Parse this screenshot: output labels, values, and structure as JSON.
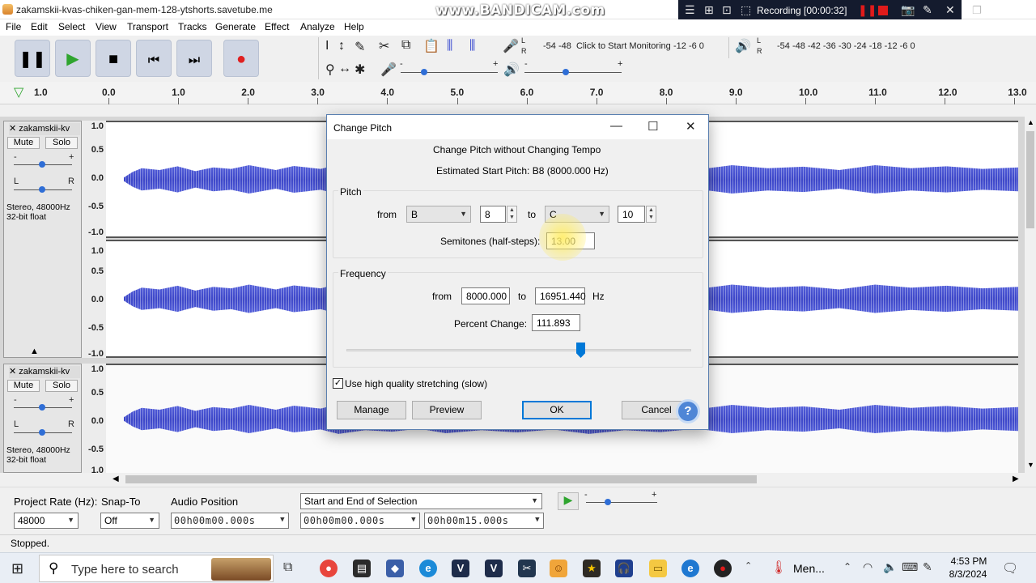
{
  "window": {
    "title": "zakamskii-kvas-chiken-gan-mem-128-ytshorts.savetube.me",
    "watermark": "www.BANDICAM.com"
  },
  "bandicam": {
    "recording_label": "Recording [00:00:32]"
  },
  "menu": [
    "File",
    "Edit",
    "Select",
    "View",
    "Transport",
    "Tracks",
    "Generate",
    "Effect",
    "Analyze",
    "Help"
  ],
  "transport": {
    "buttons": [
      "pause",
      "play",
      "stop",
      "skip-start",
      "skip-end",
      "record"
    ]
  },
  "meters": {
    "record_scale": "-54  -48",
    "record_hint": "Click to Start Monitoring",
    "record_tail": "-12  -6  0",
    "play_scale": "-54  -48  -42  -36  -30  -24  -18  -12  -6  0",
    "lr_l": "L",
    "lr_r": "R"
  },
  "ruler": {
    "start_label": "1.0",
    "ticks": [
      "0.0",
      "1.0",
      "2.0",
      "3.0",
      "4.0",
      "5.0",
      "6.0",
      "7.0",
      "8.0",
      "9.0",
      "10.0",
      "11.0",
      "12.0",
      "13.0"
    ]
  },
  "tracks": [
    {
      "name": "zakamskii-kv",
      "mute": "Mute",
      "solo": "Solo",
      "gain_minus": "-",
      "gain_plus": "+",
      "pan_l": "L",
      "pan_r": "R",
      "info_line1": "Stereo, 48000Hz",
      "info_line2": "32-bit float",
      "scale_top": [
        "1.0",
        "0.5",
        "0.0",
        "-0.5",
        "-1.0"
      ],
      "scale_bottom": [
        "1.0",
        "0.5",
        "0.0",
        "-0.5",
        "-1.0"
      ]
    },
    {
      "name": "zakamskii-kv",
      "mute": "Mute",
      "solo": "Solo",
      "gain_minus": "-",
      "gain_plus": "+",
      "pan_l": "L",
      "pan_r": "R",
      "info_line1": "Stereo, 48000Hz",
      "info_line2": "32-bit float",
      "scale_top": [
        "1.0",
        "0.5",
        "0.0",
        "-0.5",
        "1.0"
      ]
    }
  ],
  "selection_toolbar": {
    "project_rate_label": "Project Rate (Hz):",
    "project_rate_value": "48000",
    "snap_to_label": "Snap-To",
    "snap_to_value": "Off",
    "audio_position_label": "Audio Position",
    "audio_position_value": "00h00m00.000s",
    "selection_mode": "Start and End of Selection",
    "selection_start": "00h00m00.000s",
    "selection_end": "00h00m15.000s"
  },
  "status": "Stopped.",
  "dialog": {
    "title": "Change Pitch",
    "heading": "Change Pitch without Changing Tempo",
    "estimated": "Estimated Start Pitch: B8 (8000.000 Hz)",
    "pitch_group": "Pitch",
    "from_label": "from",
    "from_note": "B",
    "from_octave": "8",
    "to_label": "to",
    "to_note": "C",
    "to_octave": "10",
    "semitones_label": "Semitones (half-steps):",
    "semitones_value": "13.00",
    "frequency_group": "Frequency",
    "freq_from_label": "from",
    "freq_from": "8000.000",
    "freq_to_label": "to",
    "freq_to": "16951.440",
    "hz": "Hz",
    "percent_label": "Percent Change:",
    "percent_value": "111.893",
    "hq_checkbox": "Use high quality stretching (slow)",
    "hq_checked": true,
    "manage": "Manage",
    "preview": "Preview",
    "ok": "OK",
    "cancel": "Cancel",
    "help": "?"
  },
  "taskbar": {
    "search_placeholder": "Type here to search",
    "menu_app": "Men...",
    "time": "4:53 PM",
    "date": "8/3/2024"
  }
}
